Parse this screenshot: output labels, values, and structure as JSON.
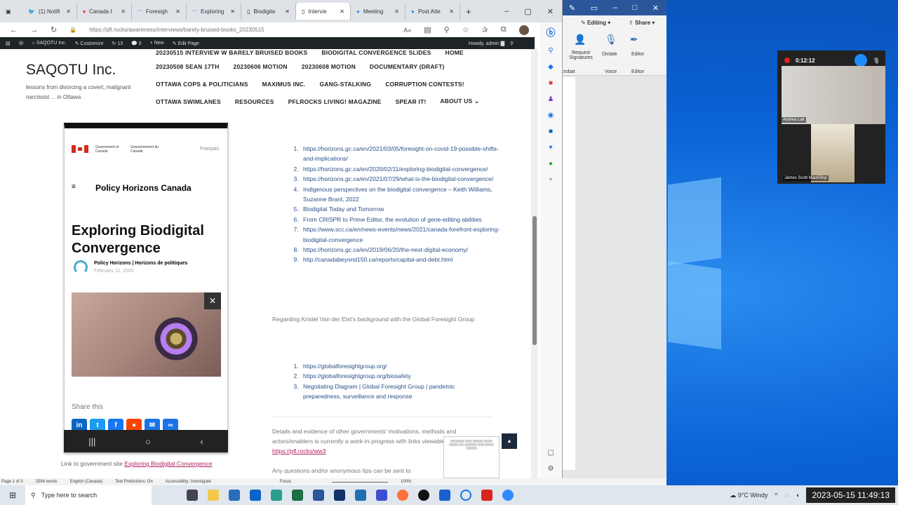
{
  "browser": {
    "tabs": [
      {
        "label": "(1) Notifi",
        "icon": "twitter-icon"
      },
      {
        "label": "Canada I",
        "icon": "maple-leaf-icon"
      },
      {
        "label": "Foresigh",
        "icon": "horizons-icon"
      },
      {
        "label": "Exploring",
        "icon": "horizons-icon"
      },
      {
        "label": "Biodigita",
        "icon": "page-icon"
      },
      {
        "label": "Intervie",
        "icon": "page-icon",
        "active": true
      },
      {
        "label": "Meeting",
        "icon": "zoom-icon"
      },
      {
        "label": "Post Atte",
        "icon": "zoom-icon"
      }
    ],
    "url": "https://pfl.rocks/awareness/interviews/barely-bruised-books_20230515",
    "wp_admin": {
      "site": "SAQOTU Inc.",
      "customize": "Customize",
      "updates": "13",
      "comments": "0",
      "new": "New",
      "edit": "Edit Page",
      "howdy": "Howdy, admin"
    }
  },
  "site": {
    "title": "SAQOTU Inc.",
    "tagline": "lessons from divorcing a covert, malignant narcissist ... in Ottawa",
    "nav": [
      [
        "20230515 INTERVIEW W BARELY BRUISED BOOKS",
        "BIODIGITAL CONVERGENCE SLIDES",
        "HOME"
      ],
      [
        "20230508 SEAN 17TH",
        "20230606 MOTION",
        "20230608 MOTION",
        "DOCUMENTARY (DRAFT)"
      ],
      [
        "OTTAWA COPS & POLITICIANS",
        "MAXIMUS INC.",
        "GANG-STALKING",
        "CORRUPTION CONTESTS!"
      ],
      [
        "OTTAWA SWIMLANES",
        "RESOURCES",
        "PFLROCKS LIVING! MAGAZINE",
        "SPEAR IT!",
        "ABOUT US ⌄"
      ]
    ]
  },
  "phone": {
    "gov_en": "Government of Canada",
    "gov_fr": "Gouvernement du Canada",
    "lang": "Français",
    "site": "Policy Horizons Canada",
    "title": "Exploring Biodigital Convergence",
    "author": "Policy Horizons | Horizons de politiques",
    "date": "February 11, 2020",
    "share": "Share this",
    "share_icons": [
      "linkedin",
      "twitter",
      "facebook",
      "reddit",
      "email",
      "link"
    ]
  },
  "caption": {
    "text": "Link to government site ",
    "link": "Exploring Biodigital Convergence"
  },
  "links1": [
    "https://horizons.gc.ca/en/2021/03/05/foresight-on-covid-19-possible-shifts-and-implications/",
    "https://horizons.gc.ca/en/2020/02/11/exploring-biodigital-convergence/",
    "https://horizons.gc.ca/en/2021/07/29/what-is-the-biodigital-convergence/",
    "Indigenous perspectives on the biodigital convergence – Keith Williams, Suzanne Brant, 2022",
    "Biodigital Today and Tomorrow",
    "From CRISPR to Prime Editor, the evolution of gene-editing abilities",
    "https://www.scc.ca/en/news-events/news/2021/canada-forefront-exploring-biodigital-convergence",
    "https://horizons.gc.ca/en/2019/06/20/the-next-digital-economy/",
    "http://canadabeyond150.ca/reports/capital-and-debt.html"
  ],
  "para1": "Regarding Kristel Van der Elst's background with the Global Foresight Group",
  "links2": [
    "https://globalforesightgroup.org/",
    "https://globalforesightgroup.org/biosafety",
    "Negotiating Diagram | Global Foresight Group | pandemic preparedness, surveillance and response"
  ],
  "para2": {
    "text": "Details and evidence of other governments' motivations, methods and actors/enablers is currently a work-in-progress with links viewable here: ",
    "link": "https://pfl.rocks/ww3"
  },
  "para3": "Any questions and/or anonymous tips can be sent to",
  "word": {
    "editing": "Editing",
    "share": "Share",
    "request": "Request Signatures",
    "dictate": "Dictate",
    "editor": "Editor",
    "group_voice": "Voice",
    "group_editor": "Editor",
    "group_acrobat": "crobat",
    "status": [
      "Page 1 of 3",
      "2594 words",
      "English (Canada)",
      "Text Predictions: On",
      "Accessibility: Investigate",
      "Focus",
      "100%"
    ]
  },
  "zoom": {
    "timer": "0:12:12",
    "participants": [
      "Andrea Lak",
      "James Scott MacKillop"
    ]
  },
  "taskbar": {
    "search_placeholder": "Type here to search",
    "weather": "9°C Windy",
    "clock": "2023-05-15 11:49:13"
  },
  "colors": {
    "wp_bar": "#1d2327",
    "link": "#2a4f8a",
    "accent_link": "#b02060",
    "word_blue": "#2b579a"
  }
}
